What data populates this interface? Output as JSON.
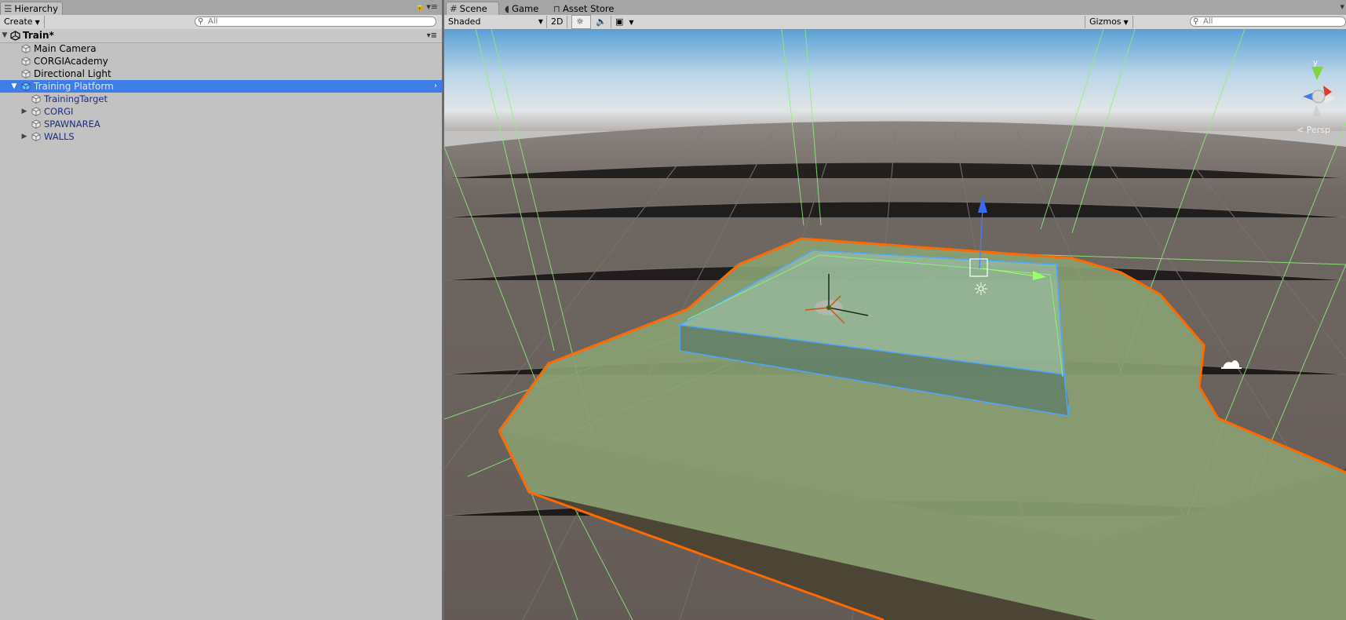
{
  "hierarchy": {
    "tab_label": "Hierarchy",
    "create_label": "Create",
    "search_placeholder": "All",
    "scene_name": "Train*",
    "items": [
      {
        "label": "Main Camera"
      },
      {
        "label": "CORGIAcademy"
      },
      {
        "label": "Directional Light"
      },
      {
        "label": "Training Platform",
        "selected": true,
        "expanded": true
      },
      {
        "label": "TrainingTarget"
      },
      {
        "label": "CORGI",
        "collapsed": true
      },
      {
        "label": "SPAWNAREA"
      },
      {
        "label": "WALLS",
        "collapsed": true
      }
    ]
  },
  "scene": {
    "tabs": [
      {
        "label": "Scene",
        "active": true,
        "icon": "grid-icon"
      },
      {
        "label": "Game",
        "icon": "pacman-icon"
      },
      {
        "label": "Asset Store",
        "icon": "shopping-bag-icon"
      }
    ],
    "shading_mode": "Shaded",
    "toggle_2d": "2D",
    "gizmos_label": "Gizmos",
    "search_placeholder": "All",
    "view_gizmo_label": "< Persp",
    "axis_y_label": "y"
  },
  "colors": {
    "selection_blue": "#3e7ce6",
    "highlight_orange": "#ff6a00",
    "collider_green": "#8cf07a",
    "zone_blue": "#4aa9ff",
    "sky_top": "#5a9fd4",
    "ground": "#6b615c"
  }
}
